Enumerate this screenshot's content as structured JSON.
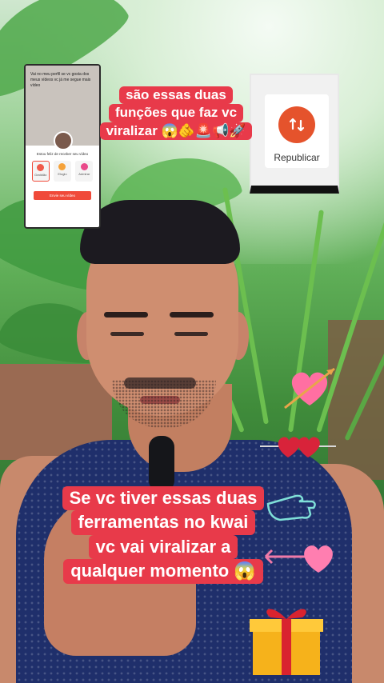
{
  "caption_top": {
    "lines": [
      "são essas duas",
      "funções que faz vc",
      "viralizar 😱🫵🚨📢🚀"
    ]
  },
  "caption_bottom": {
    "lines": [
      "Se vc tiver essas duas",
      "ferramentas no kwai",
      "vc vai viralizar a",
      "qualquer momento 😱"
    ]
  },
  "thumb_left": {
    "caption": "Vai no meu perfil se vc gosta dos meus vídeos vc já me segue mais vídeo",
    "sheet_title": "Estou feliz de receber seu vídeo",
    "options": [
      "Gratidão",
      "Elogio",
      "Admirar"
    ],
    "send_label": "Envie seu vídeo"
  },
  "thumb_right": {
    "label": "Republicar",
    "icon": "repost-icon",
    "accent": "#e5532c"
  },
  "colors": {
    "caption_bg": "#e83a4a",
    "caption_text": "#ffffff"
  }
}
